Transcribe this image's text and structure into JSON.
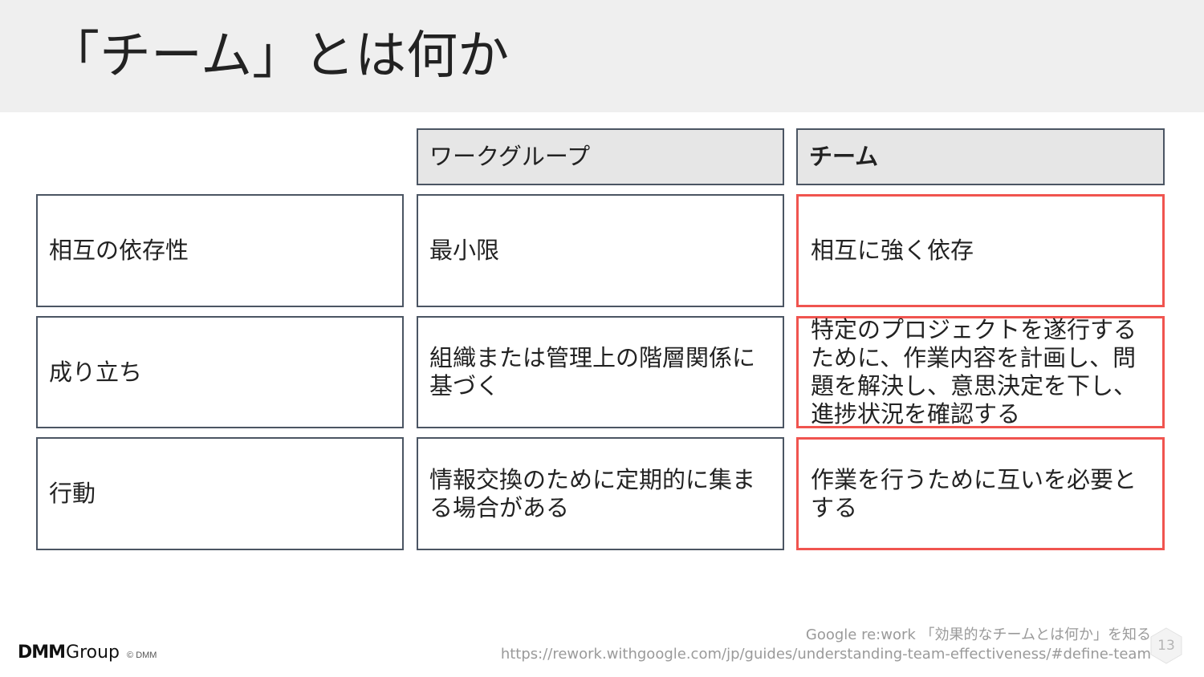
{
  "slide": {
    "title": "「チーム」とは何か",
    "page_number": "13"
  },
  "table": {
    "headers": [
      "",
      "ワークグループ",
      "チーム"
    ],
    "rows": [
      {
        "label": "相互の依存性",
        "workgroup": "最小限",
        "team": "相互に強く依存"
      },
      {
        "label": "成り立ち",
        "workgroup": "組織または管理上の階層関係に基づく",
        "team": "特定のプロジェクトを遂行するために、作業内容を計画し、問題を解決し、意思決定を下し、進捗状況を確認する"
      },
      {
        "label": "行動",
        "workgroup": "情報交換のために定期的に集まる場合がある",
        "team": "作業を行うために互いを必要とする"
      }
    ]
  },
  "source": {
    "line1": "Google re:work 「効果的なチームとは何か」を知る",
    "line2": "https://rework.withgoogle.com/jp/guides/understanding-team-effectiveness/#define-team"
  },
  "footer": {
    "logo_dmm": "DMM",
    "logo_group": "Group",
    "copyright": "© DMM"
  },
  "colors": {
    "header_bg": "#efefef",
    "border": "#4b5563",
    "highlight_border": "#f0544f",
    "header_cell_bg": "#e6e6e6"
  }
}
